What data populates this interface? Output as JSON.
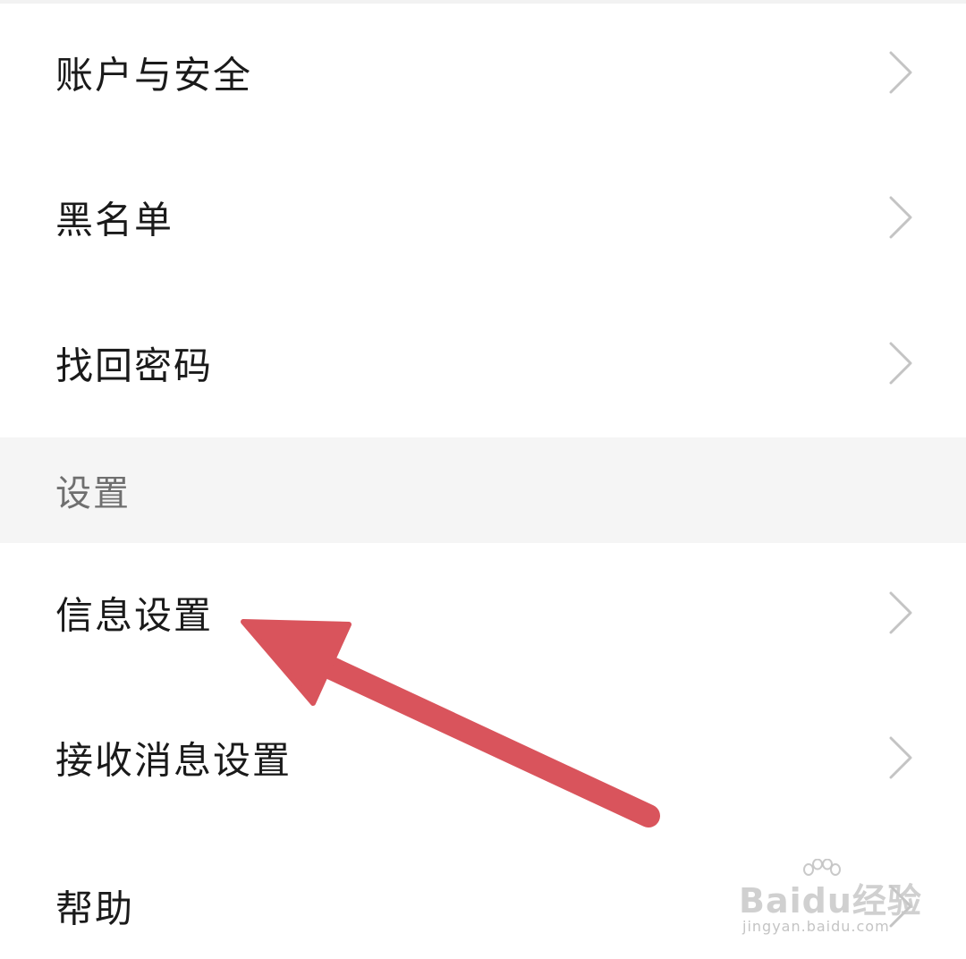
{
  "settings_list": {
    "items": [
      {
        "label": "账户与安全"
      },
      {
        "label": "黑名单"
      },
      {
        "label": "找回密码"
      },
      {
        "label": "信息设置"
      },
      {
        "label": "接收消息设置"
      },
      {
        "label": "帮助"
      }
    ],
    "section_header": "设置"
  },
  "annotation": {
    "arrow_color": "#d9545c",
    "target": "信息设置"
  },
  "watermark": {
    "logo_text": "Baidu经验",
    "url_text": "jingyan.baidu.com"
  },
  "icons": {
    "chevron": "chevron-right-icon"
  },
  "colors": {
    "background": "#ffffff",
    "section_background": "#f5f5f5",
    "chevron": "#c4c4c4",
    "text": "#1a1a1a",
    "section_text": "#6f6f6f"
  }
}
